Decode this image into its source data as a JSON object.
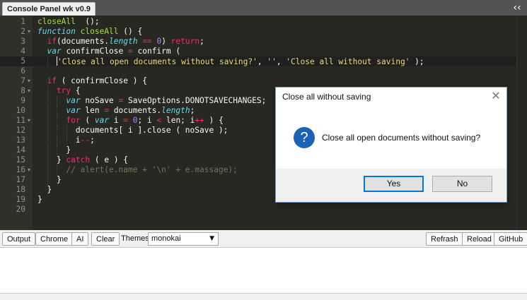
{
  "panel": {
    "title": "Console Panel wk v0.9",
    "collapse_glyph": "‹‹"
  },
  "editor": {
    "line_numbers": [
      "1",
      "2",
      "3",
      "4",
      "5",
      "6",
      "7",
      "8",
      "9",
      "10",
      "11",
      "12",
      "13",
      "14",
      "15",
      "16",
      "17",
      "18",
      "19",
      "20"
    ],
    "folded_lines": [
      2,
      7,
      8,
      11,
      16
    ],
    "active_line": 5,
    "lines": [
      [
        [
          "fn",
          "closeAll"
        ],
        [
          "",
          "  ();"
        ]
      ],
      [
        [
          "st",
          "function"
        ],
        [
          "",
          ""
        ],
        [
          "fn",
          " closeAll"
        ],
        [
          "",
          " () {"
        ]
      ],
      [
        [
          "",
          "  "
        ],
        [
          "kw",
          "if"
        ],
        [
          "",
          "(documents."
        ],
        [
          "st",
          "length"
        ],
        [
          "kw",
          " =="
        ],
        [
          "num",
          " 0"
        ],
        [
          "",
          ") "
        ],
        [
          "kw",
          "return"
        ],
        [
          "",
          ";"
        ]
      ],
      [
        [
          "",
          "  "
        ],
        [
          "st",
          "var"
        ],
        [
          "",
          " confirmClose "
        ],
        [
          "kw",
          "="
        ],
        [
          "",
          " confirm ("
        ]
      ],
      [
        [
          "",
          "    "
        ],
        [
          "str",
          "'Close all open documents without saving?'"
        ],
        [
          "",
          ", "
        ],
        [
          "str",
          "''"
        ],
        [
          "",
          ", "
        ],
        [
          "str",
          "'Close all without saving'"
        ],
        [
          "",
          " );"
        ]
      ],
      [],
      [
        [
          "",
          "  "
        ],
        [
          "kw",
          "if"
        ],
        [
          "",
          " ( confirmClose ) {"
        ]
      ],
      [
        [
          "",
          "    "
        ],
        [
          "kw",
          "try"
        ],
        [
          "",
          " {"
        ]
      ],
      [
        [
          "",
          "      "
        ],
        [
          "st",
          "var"
        ],
        [
          "",
          " noSave "
        ],
        [
          "kw",
          "="
        ],
        [
          "",
          " SaveOptions.DONOTSAVECHANGES;"
        ]
      ],
      [
        [
          "",
          "      "
        ],
        [
          "st",
          "var"
        ],
        [
          "",
          " len "
        ],
        [
          "kw",
          "="
        ],
        [
          "",
          " documents."
        ],
        [
          "st",
          "length"
        ],
        [
          "",
          ";"
        ]
      ],
      [
        [
          "",
          "      "
        ],
        [
          "kw",
          "for"
        ],
        [
          "",
          " ( "
        ],
        [
          "st",
          "var"
        ],
        [
          "",
          " i "
        ],
        [
          "kw",
          "="
        ],
        [
          "num",
          " 0"
        ],
        [
          "",
          "; i "
        ],
        [
          "kw",
          "<"
        ],
        [
          "",
          " len; i"
        ],
        [
          "kw",
          "++"
        ],
        [
          "",
          " ) {"
        ]
      ],
      [
        [
          "",
          "        documents[ i ].close ( noSave );"
        ]
      ],
      [
        [
          "",
          "        i"
        ],
        [
          "kw",
          "--"
        ],
        [
          "",
          ";"
        ]
      ],
      [
        [
          "",
          "      }"
        ]
      ],
      [
        [
          "",
          "    } "
        ],
        [
          "kw",
          "catch"
        ],
        [
          "",
          " ( e ) {"
        ]
      ],
      [
        [
          "",
          "      "
        ],
        [
          "cm",
          "// alert(e.name + '\\n' + e.massage);"
        ]
      ],
      [
        [
          "",
          "    }"
        ]
      ],
      [
        [
          "",
          "  }"
        ]
      ],
      [
        [
          "",
          "}"
        ]
      ],
      []
    ]
  },
  "toolbar": {
    "output_label": "Output",
    "chrome_label": "Chrome",
    "ai_label": "AI",
    "clear_label": "Clear",
    "themes_label": "Themes",
    "theme_value": "monokai",
    "theme_arrow": "▼",
    "refresh_label": "Refrash",
    "reload_label": "Reload",
    "github_label": "GitHub"
  },
  "dialog": {
    "title": "Close all without saving",
    "close_glyph": "✕",
    "icon_glyph": "?",
    "message": "Close all open documents without saving?",
    "yes_label": "Yes",
    "no_label": "No"
  },
  "colors": {
    "editor_bg": "#272822",
    "keyword": "#f92672",
    "storage": "#66d9ef",
    "function": "#a6e22e",
    "number": "#ae81ff",
    "string": "#e6db74",
    "comment": "#75715e",
    "dialog_accent": "#0078d7"
  }
}
